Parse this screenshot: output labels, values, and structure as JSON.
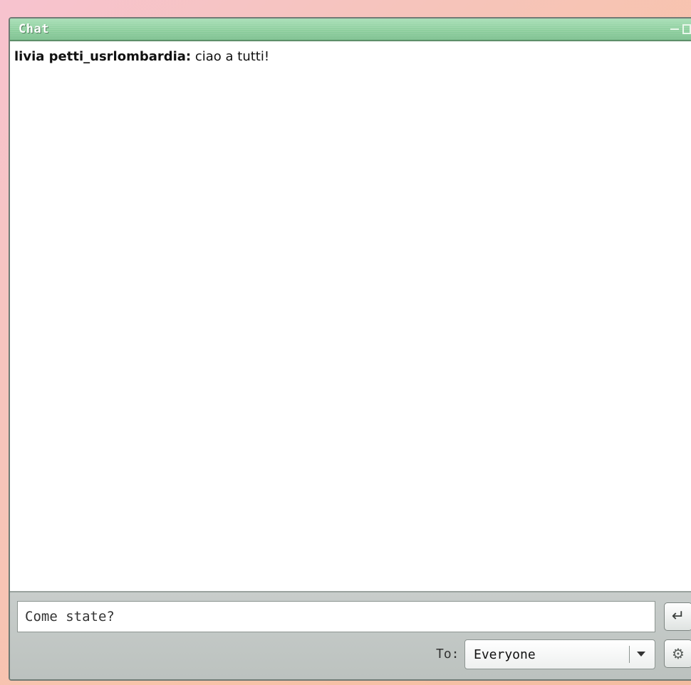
{
  "window": {
    "title": "Chat",
    "controls": {
      "minimize_icon": "minimize-icon",
      "maximize_icon": "maximize-icon"
    }
  },
  "messages": [
    {
      "sender": "livia petti_usrlombardia:",
      "text": " ciao a tutti!"
    }
  ],
  "compose": {
    "value": "Come state?",
    "send_icon": "enter-icon",
    "send_glyph": "↵"
  },
  "recipient": {
    "label": "To:",
    "selected": "Everyone",
    "dropdown_icon": "chevron-down-icon"
  },
  "options": {
    "icon": "gear-icon",
    "glyph": "⚙"
  },
  "colors": {
    "titlebar": "#8fcf9f",
    "toolbar": "#c3c8c6",
    "background_pink": "#f7c3cf",
    "background_peach": "#f3bca0"
  }
}
